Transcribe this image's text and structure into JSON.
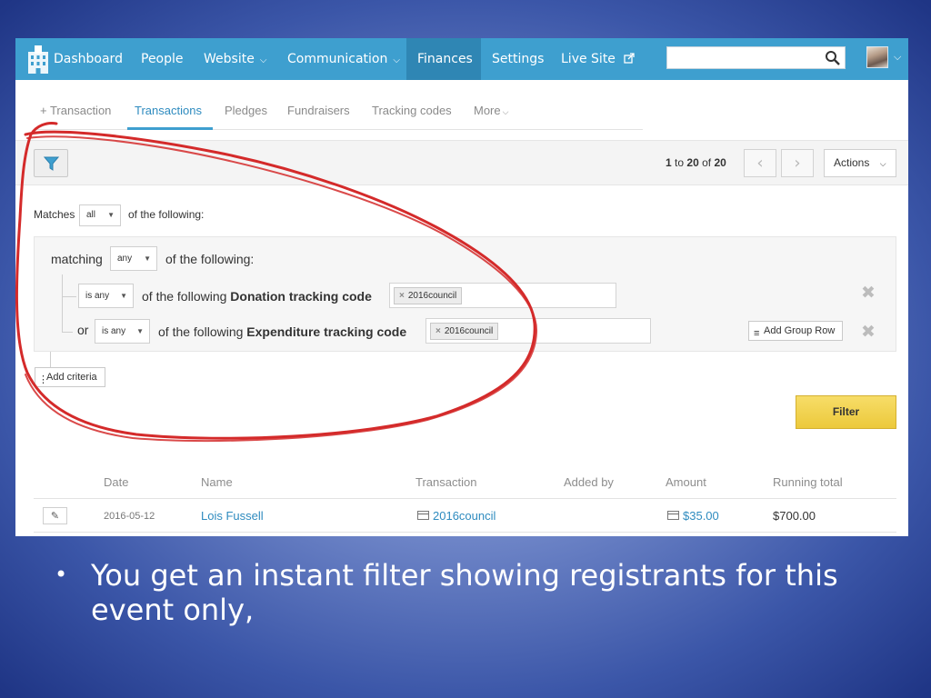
{
  "nav": {
    "items": [
      {
        "label": "Dashboard",
        "has_caret": false
      },
      {
        "label": "People",
        "has_caret": false
      },
      {
        "label": "Website",
        "has_caret": true
      },
      {
        "label": "Communication",
        "has_caret": true
      },
      {
        "label": "Finances",
        "has_caret": false,
        "active": true
      },
      {
        "label": "Settings",
        "has_caret": false
      },
      {
        "label": "Live Site",
        "has_caret": false
      }
    ],
    "search_placeholder": "",
    "accent_color": "#3e9fcf",
    "active_color": "#2f86b4"
  },
  "subtabs": {
    "items": [
      {
        "label": "+ Transaction"
      },
      {
        "label": "Transactions",
        "active": true
      },
      {
        "label": "Pledges"
      },
      {
        "label": "Fundraisers"
      },
      {
        "label": "Tracking codes"
      },
      {
        "label": "More"
      }
    ]
  },
  "toolbar": {
    "pager_from": "1",
    "pager_to_word": "to",
    "pager_to": "20",
    "pager_of_word": "of",
    "pager_total": "20",
    "prev_icon": "chevron-left-icon",
    "next_icon": "chevron-right-icon",
    "actions_label": "Actions"
  },
  "filter": {
    "matches_label": "Matches",
    "matches_value": "all",
    "of_following": "of the following:",
    "group": {
      "matching_label": "matching",
      "matching_value": "any",
      "of_following": "of the following:",
      "rows": [
        {
          "connector": "",
          "operator": "is any",
          "prefix": "of the following",
          "field": "Donation tracking code",
          "tag": "2016council"
        },
        {
          "connector": "or",
          "operator": "is any",
          "prefix": "of the following",
          "field": "Expenditure tracking code",
          "tag": "2016council"
        }
      ],
      "add_group_row_label": "Add Group Row"
    },
    "add_criteria_label": "Add criteria",
    "filter_button_label": "Filter"
  },
  "table": {
    "headers": [
      "Date",
      "Name",
      "Transaction",
      "Added by",
      "Amount",
      "Running total"
    ],
    "rows": [
      {
        "date": "2016-05-12",
        "name": "Lois Fussell",
        "transaction": "2016council",
        "added_by": "",
        "amount": "$35.00",
        "running_total": "$700.00"
      }
    ]
  },
  "slide": {
    "bullet": "You get an instant filter showing registrants for this event only,"
  }
}
